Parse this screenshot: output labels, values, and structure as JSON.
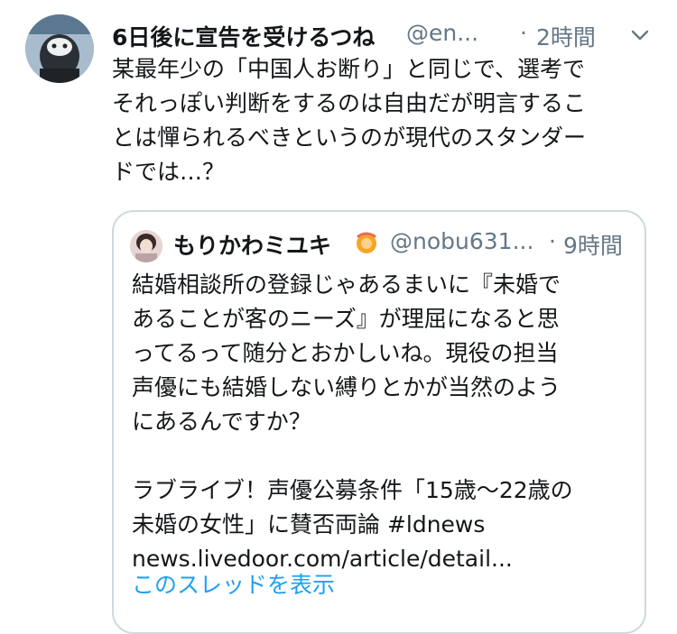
{
  "tweet": {
    "display_name": "6日後に宣告を受けるつね",
    "handle": "@en...",
    "separator": "·",
    "time": "2時間",
    "body_lines": [
      "某最年少の「中国人お断り」と同じで、選考で",
      "それっぽい判断をするのは自由だが明言するこ",
      "とは憚られるべきというのが現代のスタンダー",
      "ドでは…？"
    ]
  },
  "quoted": {
    "display_name": "もりかわミユキ",
    "handle": "@nobu631...",
    "separator": "·",
    "time": "9時間",
    "text_lines": [
      "結婚相談所の登録じゃあるまいに『未婚で",
      "あることが客のニーズ』が理屈になると思",
      "ってるって随分とおかしいね。現役の担当",
      "声優にも結婚しない縛りとかが当然のよう",
      "にあるんですか？"
    ],
    "link_title_lines": [
      "ラブライブ！声優公募条件「15歳〜22歳の",
      "未婚の女性」に賛否両論 #ldnews"
    ],
    "link_url": "news.livedoor.com/article/detail...",
    "show_thread": "このスレッドを表示"
  },
  "colors": {
    "text": "#14171a",
    "secondary": "#657786",
    "link": "#1da1f2",
    "border": "#cfd9de"
  },
  "icons": [
    "avatar",
    "chevron-down-icon",
    "quoted-avatar",
    "emoji-icon"
  ]
}
